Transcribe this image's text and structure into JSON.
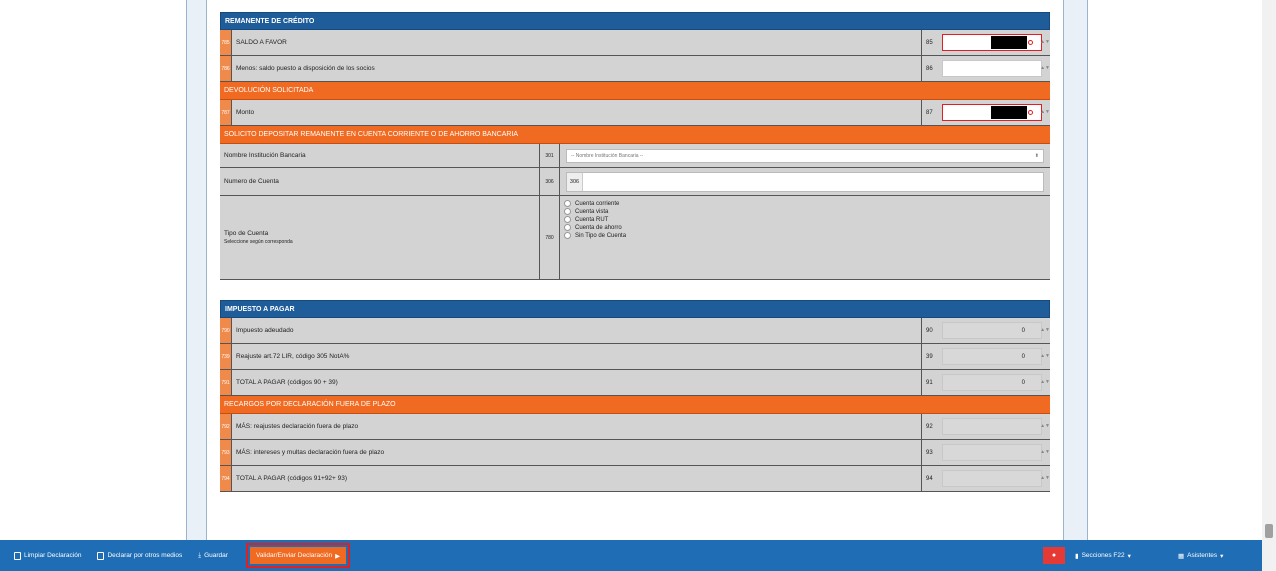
{
  "remanente": {
    "title": "REMANENTE DE CRÉDITO",
    "rows": [
      {
        "num": "785",
        "label": "SALDO A FAVOR",
        "code": "85",
        "value": ""
      },
      {
        "num": "786",
        "label": "Menos: saldo puesto a disposición de los socios",
        "code": "86",
        "value": ""
      }
    ]
  },
  "devolucion": {
    "title": "DEVOLUCIÓN SOLICITADA",
    "rows": [
      {
        "num": "787",
        "label": "Monto",
        "code": "87",
        "value": ""
      }
    ]
  },
  "deposito": {
    "title": "SOLICITO DEPOSITAR REMANENTE EN CUENTA CORRIENTE O DE AHORRO BANCARIA",
    "bank_label": "Nombre Institución Bancaria",
    "bank_code": "301",
    "bank_placeholder": "-- Nombre Institución Bancaria --",
    "account_label": "Numero de Cuenta",
    "account_code": "306",
    "account_prefix": "306",
    "type_label": "Tipo de Cuenta",
    "type_sublabel": "Seleccione según corresponda",
    "type_code": "780",
    "type_options": [
      "Cuenta corriente",
      "Cuenta vista",
      "Cuenta RUT",
      "Cuenta de ahorro",
      "Sin Tipo de Cuenta"
    ]
  },
  "impuesto": {
    "title": "IMPUESTO A PAGAR",
    "rows": [
      {
        "num": "790",
        "label": "Impuesto adeudado",
        "code": "90",
        "value": "0"
      },
      {
        "num": "739",
        "label": "Reajuste art.72 LIR, código 305 NotA%",
        "code": "39",
        "value": "0"
      },
      {
        "num": "791",
        "label": "TOTAL A PAGAR (códigos 90 + 39)",
        "code": "91",
        "value": "0"
      }
    ]
  },
  "recargos": {
    "title": "RECARGOS POR DECLARACIÓN FUERA DE PLAZO",
    "rows": [
      {
        "num": "792",
        "label": "MÁS: reajustes declaración fuera de plazo",
        "code": "92",
        "value": ""
      },
      {
        "num": "793",
        "label": "MÁS: intereses y multas declaración fuera de plazo",
        "code": "93",
        "value": ""
      },
      {
        "num": "794",
        "label": "TOTAL A PAGAR (códigos 91+92+ 93)",
        "code": "94",
        "value": ""
      }
    ]
  },
  "bottombar": {
    "limpiar": "Limpiar Declaración",
    "declarar_otros": "Declarar por otros medios",
    "guardar": "Guardar",
    "validar": "Validar/Enviar Declaración",
    "secciones": "Secciones F22",
    "asistentes": "Asistentes"
  },
  "colors": {
    "header_blue": "#1f5d9a",
    "accent_orange": "#f06a22",
    "bar_blue": "#1f6db4",
    "alert_red": "#e53935"
  }
}
